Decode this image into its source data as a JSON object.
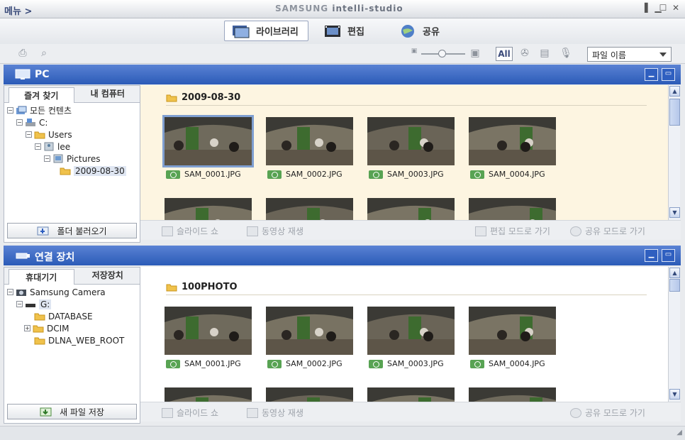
{
  "titlebar": {
    "menu": "메뉴 >",
    "brand_a": "SAMSUNG",
    "brand_b": "intelli-studio"
  },
  "modes": [
    {
      "label": "라이브러리",
      "icon": "library-icon",
      "active": true
    },
    {
      "label": "편집",
      "icon": "film-icon",
      "active": false
    },
    {
      "label": "공유",
      "icon": "globe-icon",
      "active": false
    }
  ],
  "toolbar": {
    "all_label": "All",
    "sort_value": "파일 이름"
  },
  "pc_section": {
    "title": "PC",
    "tabs": [
      "즐겨 찾기",
      "내 컴퓨터"
    ],
    "tree": [
      {
        "label": "모든 컨텐츠",
        "level": 0,
        "exp": "⊟"
      },
      {
        "label": "C:",
        "level": 1,
        "exp": "⊟"
      },
      {
        "label": "Users",
        "level": 2,
        "exp": "⊟"
      },
      {
        "label": "lee",
        "level": 3,
        "exp": "⊟"
      },
      {
        "label": "Pictures",
        "level": 4,
        "exp": "⊟"
      },
      {
        "label": "2009-08-30",
        "level": 5,
        "exp": ""
      }
    ],
    "load_button": "폴더 불러오기",
    "folder": "2009-08-30",
    "photos": [
      "SAM_0001.JPG",
      "SAM_0002.JPG",
      "SAM_0003.JPG",
      "SAM_0004.JPG"
    ],
    "actions": {
      "slideshow": "슬라이드 쇼",
      "video": "동영상 재생",
      "edit_mode": "편집 모드로 가기",
      "share_mode": "공유 모드로 가기"
    }
  },
  "device_section": {
    "title": "연결 장치",
    "tabs": [
      "휴대기기",
      "저장장치"
    ],
    "tree": [
      {
        "label": "Samsung Camera",
        "level": 0,
        "exp": "⊟"
      },
      {
        "label": "G:",
        "level": 1,
        "exp": "⊟"
      },
      {
        "label": "DATABASE",
        "level": 2,
        "exp": ""
      },
      {
        "label": "DCIM",
        "level": 2,
        "exp": "⊞"
      },
      {
        "label": "DLNA_WEB_ROOT",
        "level": 2,
        "exp": ""
      }
    ],
    "save_button": "새 파일 저장",
    "folder": "100PHOTO",
    "photos": [
      "SAM_0001.JPG",
      "SAM_0002.JPG",
      "SAM_0003.JPG",
      "SAM_0004.JPG"
    ],
    "actions": {
      "slideshow": "슬라이드 쇼",
      "video": "동영상 재생",
      "share_mode": "공유 모드로 가기"
    }
  },
  "colors": {
    "header_blue": "#2b5bb8",
    "content_pc_bg": "#fdf5e1",
    "content_dev_bg": "#ffffff",
    "cam_tag": "#58a353"
  }
}
